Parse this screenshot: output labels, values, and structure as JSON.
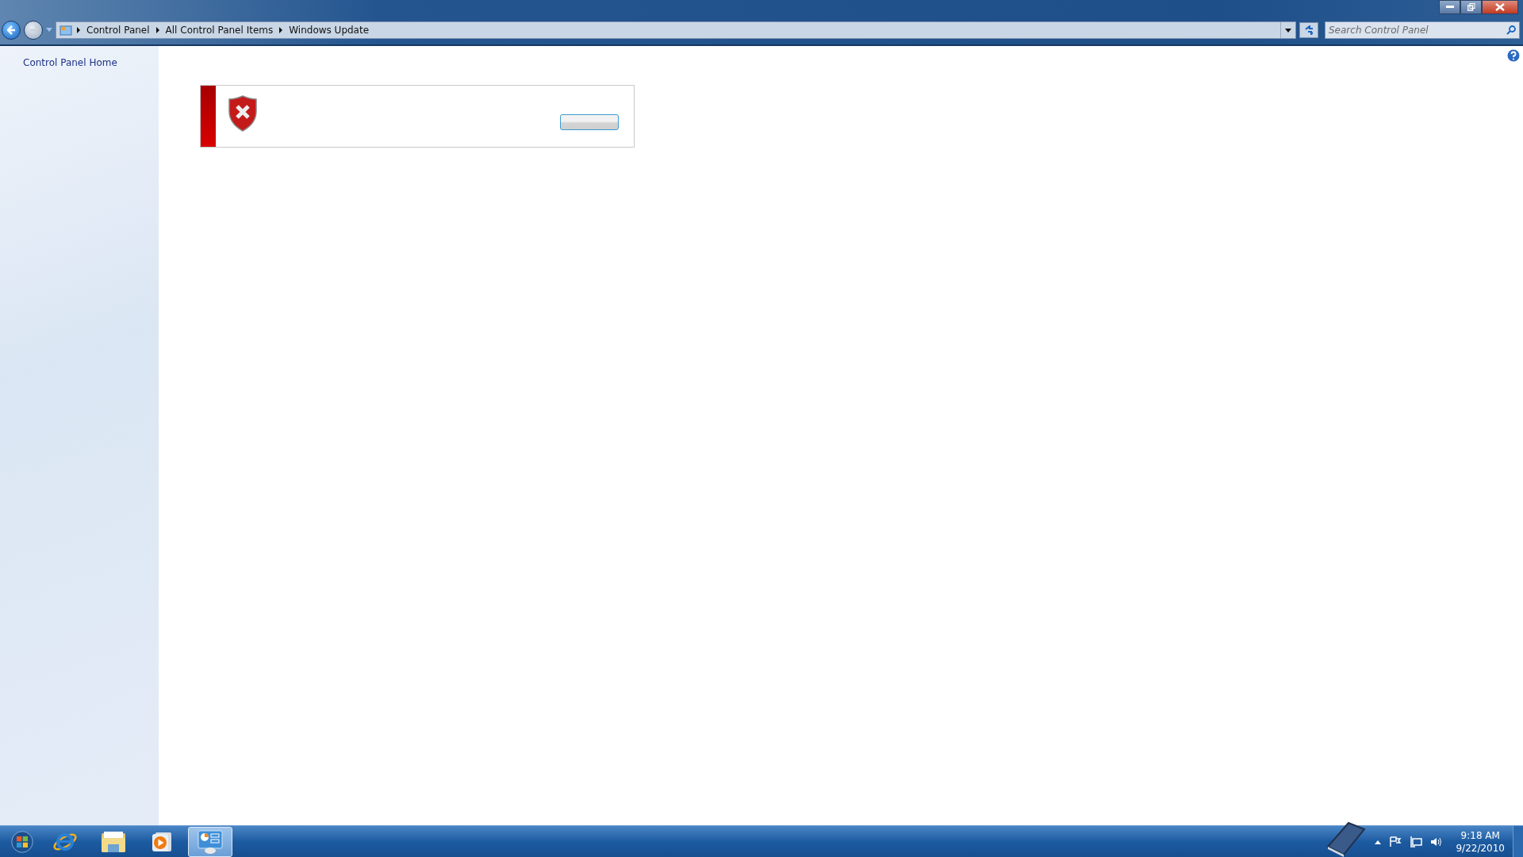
{
  "address_bar": {
    "breadcrumbs": [
      "Control Panel",
      "All Control Panel Items",
      "Windows Update"
    ]
  },
  "search": {
    "placeholder": "Search Control Panel"
  },
  "sidebar": {
    "items": [
      "Control Panel Home"
    ]
  },
  "taskbar": {
    "apps": [
      {
        "kind": "browser",
        "selected": false
      },
      {
        "kind": "folder",
        "selected": false
      },
      {
        "kind": "media",
        "selected": false
      },
      {
        "kind": "control-panel",
        "selected": true
      }
    ]
  },
  "clock": {
    "time": "9:18 AM",
    "date": "9/22/2010"
  }
}
